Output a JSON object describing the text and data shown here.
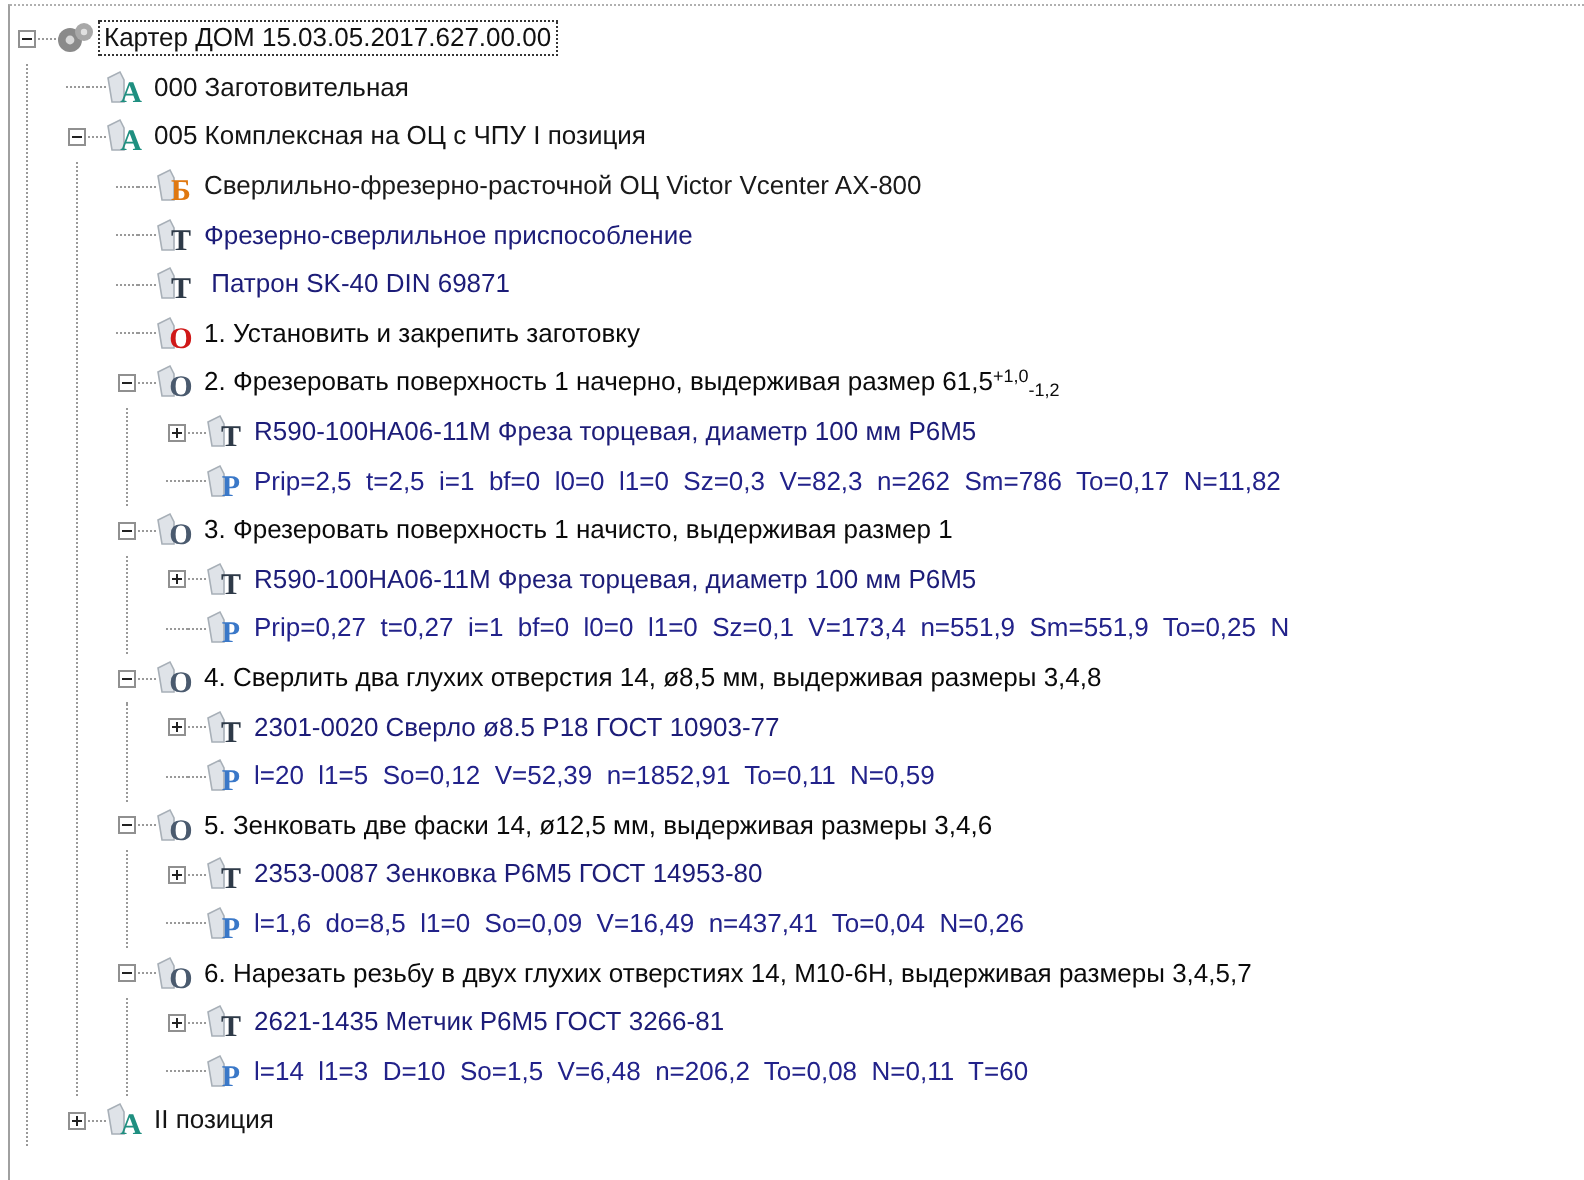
{
  "tree": {
    "text": "Картер ДОМ 15.03.05.2017.627.00.00",
    "kind": "root",
    "expanded": true,
    "selected": true,
    "children": [
      {
        "text": "000 Заготовительная",
        "kind": "operation",
        "letter": "A",
        "color": "#1f8f80",
        "selected": false
      },
      {
        "text": "005 Комплексная на ОЦ с ЧПУ I позиция",
        "kind": "operation",
        "letter": "A",
        "color": "#1f8f80",
        "expanded": true,
        "selected": false,
        "children": [
          {
            "text": "Сверлильно-фрезерно-расточной ОЦ Victor Vcenter AX-800",
            "kind": "equipment",
            "letter": "Б",
            "color": "#e07810",
            "selected": false
          },
          {
            "text": "Фрезерно-сверлильное приспособление",
            "kind": "tooling",
            "letter": "T",
            "color": "#2e3a48",
            "selected": false
          },
          {
            "text": " Патрон SK-40 DIN 69871",
            "kind": "tooling",
            "letter": "T",
            "color": "#2e3a48",
            "selected": false
          },
          {
            "text": "1. Установить и закрепить заготовку",
            "kind": "step",
            "letter": "O",
            "color": "#d01818",
            "selected": false
          },
          {
            "text": "2. Фрезеровать поверхность 1 начерно, выдерживая размер 61,5$^{+1,0}$$_{-1,2}$",
            "kind": "step",
            "letter": "O",
            "color": "#4a5a6e",
            "expanded": true,
            "selected": false,
            "children": [
              {
                "text": "R590-100HA06-11M Фреза торцевая, диаметр 100 мм Р6М5",
                "kind": "tooling",
                "letter": "T",
                "color": "#2e3a48",
                "expanded": false,
                "selected": false
              },
              {
                "text": "Prip=2,5  t=2,5  i=1  bf=0  l0=0  l1=0  Sz=0,3  V=82,3  n=262  Sm=786  To=0,17  N=11,82",
                "kind": "params",
                "letter": "P",
                "color": "#3a78c8",
                "selected": false
              }
            ]
          },
          {
            "text": "3. Фрезеровать поверхность 1 начисто, выдерживая размер 1",
            "kind": "step",
            "letter": "O",
            "color": "#4a5a6e",
            "expanded": true,
            "selected": false,
            "children": [
              {
                "text": "R590-100HA06-11M Фреза торцевая, диаметр 100 мм Р6М5",
                "kind": "tooling",
                "letter": "T",
                "color": "#2e3a48",
                "expanded": false,
                "selected": false
              },
              {
                "text": "Prip=0,27  t=0,27  i=1  bf=0  l0=0  l1=0  Sz=0,1  V=173,4  n=551,9  Sm=551,9  To=0,25  N",
                "kind": "params",
                "letter": "P",
                "color": "#3a78c8",
                "selected": false
              }
            ]
          },
          {
            "text": "4. Сверлить два глухих отверстия 14, ø8,5 мм, выдерживая размеры 3,4,8",
            "kind": "step",
            "letter": "O",
            "color": "#4a5a6e",
            "expanded": true,
            "selected": false,
            "children": [
              {
                "text": "2301-0020 Сверло ø8.5 Р18 ГОСТ 10903-77",
                "kind": "tooling",
                "letter": "T",
                "color": "#2e3a48",
                "expanded": false,
                "selected": false
              },
              {
                "text": "l=20  l1=5  So=0,12  V=52,39  n=1852,91  To=0,11  N=0,59",
                "kind": "params",
                "letter": "P",
                "color": "#3a78c8",
                "selected": false
              }
            ]
          },
          {
            "text": "5. Зенковать две фаски 14, ø12,5 мм, выдерживая размеры 3,4,6",
            "kind": "step",
            "letter": "O",
            "color": "#4a5a6e",
            "expanded": true,
            "selected": false,
            "children": [
              {
                "text": "2353-0087 Зенковка Р6М5 ГОСТ 14953-80",
                "kind": "tooling",
                "letter": "T",
                "color": "#2e3a48",
                "expanded": false,
                "selected": false
              },
              {
                "text": "l=1,6  do=8,5  l1=0  So=0,09  V=16,49  n=437,41  To=0,04  N=0,26",
                "kind": "params",
                "letter": "P",
                "color": "#3a78c8",
                "selected": false
              }
            ]
          },
          {
            "text": "6. Нарезать резьбу в двух глухих отверстиях 14, М10-6Н, выдерживая размеры 3,4,5,7",
            "kind": "step",
            "letter": "O",
            "color": "#4a5a6e",
            "expanded": true,
            "selected": false,
            "children": [
              {
                "text": "2621-1435 Метчик Р6М5 ГОСТ 3266-81",
                "kind": "tooling",
                "letter": "T",
                "color": "#2e3a48",
                "expanded": false,
                "selected": false
              },
              {
                "text": "l=14  l1=3  D=10  So=1,5  V=6,48  n=206,2  To=0,08  N=0,11  T=60",
                "kind": "params",
                "letter": "P",
                "color": "#3a78c8",
                "selected": false
              }
            ]
          }
        ]
      },
      {
        "text": "II позиция",
        "kind": "operation",
        "letter": "A",
        "color": "#1f8f80",
        "expanded": false,
        "selected": false
      }
    ]
  }
}
